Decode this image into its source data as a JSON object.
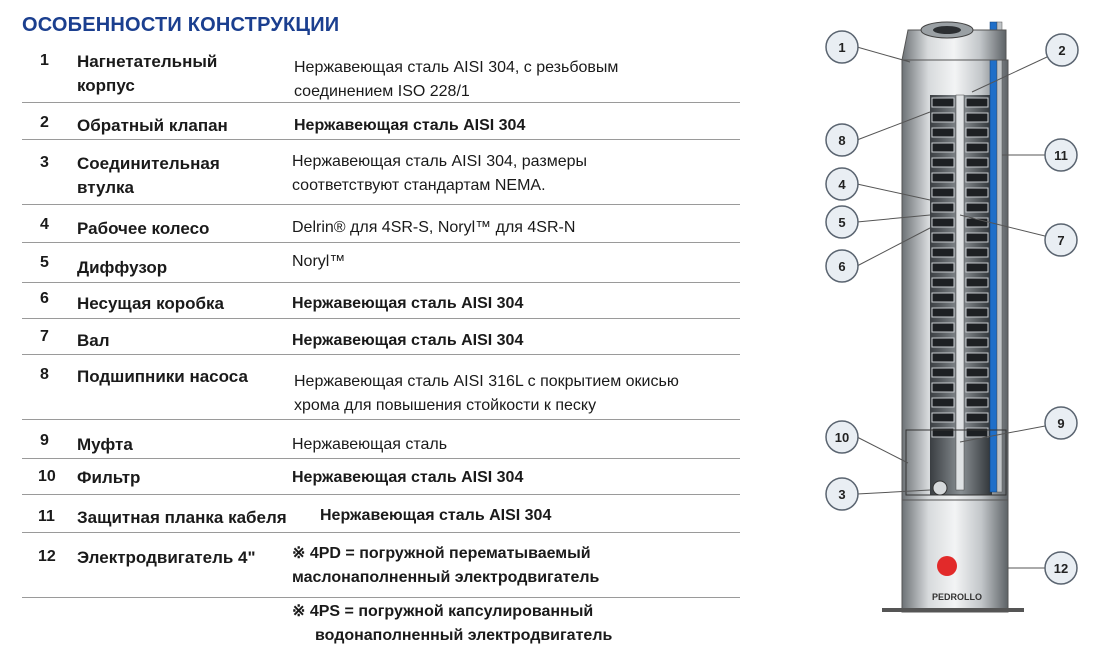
{
  "title": "ОСОБЕННОСТИ КОНСТРУКЦИИ",
  "rows": [
    {
      "num": "1",
      "name_lines": [
        "Нагнетательный",
        "корпус"
      ],
      "desc_lines": [
        "Нержавеющая сталь AISI 304, с резьбовым",
        "соединением ISO 228/1"
      ],
      "bold": false
    },
    {
      "num": "2",
      "name_lines": [
        "Обратный клапан"
      ],
      "desc_lines": [
        "Нержавеющая сталь AISI 304"
      ],
      "bold": true
    },
    {
      "num": "3",
      "name_lines": [
        "Соединительная",
        "втулка"
      ],
      "desc_lines": [
        "Нержавеющая сталь AISI 304, размеры",
        "соответствуют стандартам NEMA."
      ],
      "bold": false
    },
    {
      "num": "4",
      "name_lines": [
        "Рабочее колесо"
      ],
      "desc_lines": [
        "Delrin® для 4SR-S, Noryl™ для 4SR-N"
      ],
      "bold": false
    },
    {
      "num": "5",
      "name_lines": [
        "Диффузор"
      ],
      "desc_lines": [
        "Noryl™"
      ],
      "bold": false
    },
    {
      "num": "6",
      "name_lines": [
        "Несущая коробка"
      ],
      "desc_lines": [
        "Нержавеющая сталь AISI 304"
      ],
      "bold": true
    },
    {
      "num": "7",
      "name_lines": [
        "Вал"
      ],
      "desc_lines": [
        "Нержавеющая сталь AISI 304"
      ],
      "bold": true
    },
    {
      "num": "8",
      "name_lines": [
        "Подшипники насоса"
      ],
      "desc_lines": [
        "Нержавеющая сталь AISI 316L с покрытием окисью",
        "хрома для повышения стойкости к песку"
      ],
      "bold": false
    },
    {
      "num": "9",
      "name_lines": [
        "Муфта"
      ],
      "desc_lines": [
        "Нержавеющая сталь"
      ],
      "bold": false
    },
    {
      "num": "10",
      "name_lines": [
        "Фильтр"
      ],
      "desc_lines": [
        "Нержавеющая сталь AISI 304"
      ],
      "bold": true
    },
    {
      "num": "11",
      "name_lines": [
        "Защитная планка кабеля"
      ],
      "desc_lines": [
        "Нержавеющая сталь AISI 304"
      ],
      "bold": true
    },
    {
      "num": "12",
      "name_lines": [
        "Электродвигатель 4\""
      ],
      "desc_lines": [
        "※ 4PD = погружной перематываемый",
        "маслонаполненный электродвигатель"
      ],
      "bold": true
    }
  ],
  "extra_lines": [
    "※ 4PS = погружной капсулированный",
    "водонаполненный электродвигатель"
  ],
  "callouts": [
    "1",
    "2",
    "8",
    "11",
    "4",
    "5",
    "7",
    "6",
    "10",
    "9",
    "3",
    "12"
  ],
  "brand": "PEDROLLO",
  "colors": {
    "title": "#1b3f8f",
    "cable": "#1f6fc9",
    "callout_fill": "#e9eef3",
    "callout_stroke": "#5a6470"
  }
}
